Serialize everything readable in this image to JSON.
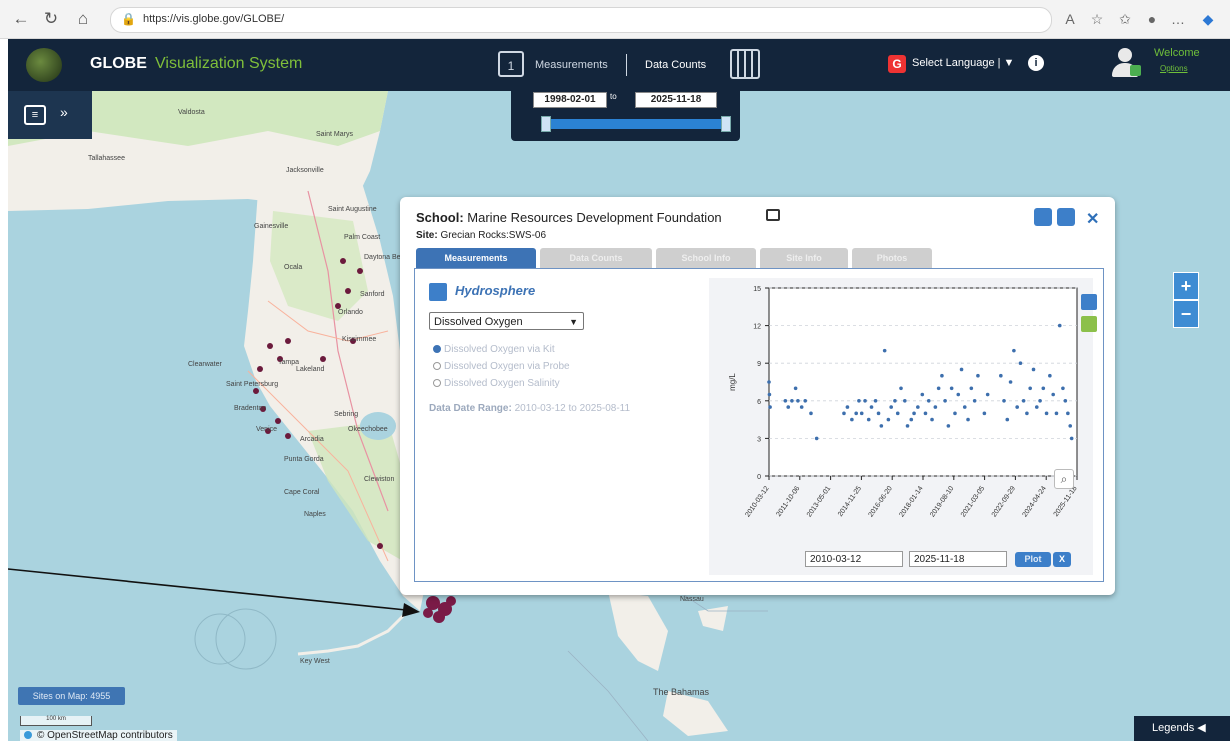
{
  "browser": {
    "url": "https://vis.globe.gov/GLOBE/"
  },
  "header": {
    "brand_main": "GLOBE",
    "brand_sub": "Visualization System",
    "measurements_label": "Measurements",
    "data_counts_label": "Data Counts",
    "language_label": "Select Language | ▼",
    "welcome_label": "Welcome",
    "options_label": "Options"
  },
  "date_range": {
    "start": "1998-02-01",
    "to_label": "to",
    "end": "2025-11-18",
    "slider_start_fraction": 0.0,
    "slider_end_fraction": 1.0
  },
  "map": {
    "sites_on_map": "Sites on Map: 4955",
    "scale_label": "100 km",
    "attribution": "© OpenStreetMap contributors",
    "legends_label": "Legends",
    "zoom_in": "+",
    "zoom_out": "−",
    "places": [
      "Valdosta",
      "Saint Marys",
      "Tallahassee",
      "Jacksonville",
      "Saint Augustine",
      "Gainesville",
      "Palm Coast",
      "Ocala",
      "Daytona Beach",
      "Sanford",
      "Orlando",
      "Kissimmee",
      "Clearwater",
      "Tampa",
      "Lakeland",
      "Saint Petersburg",
      "Bradenton",
      "Sebring",
      "Venice",
      "Arcadia",
      "Okeechobee",
      "Punta Gorda",
      "Cape Coral",
      "Clewiston",
      "Naples",
      "Key West",
      "Nassau",
      "The Bahamas"
    ]
  },
  "popup": {
    "school_label": "School:",
    "school_name": "Marine Resources Development Foundation",
    "site_label": "Site:",
    "site_name": "Grecian Rocks:SWS-06",
    "close": "✕",
    "tabs": [
      {
        "label": "Measurements",
        "active": true
      },
      {
        "label": "Data Counts",
        "active": false
      },
      {
        "label": "School Info",
        "active": false
      },
      {
        "label": "Site Info",
        "active": false
      },
      {
        "label": "Photos",
        "active": false
      }
    ],
    "sphere_title": "Hydrosphere",
    "selected_measure": "Dissolved Oxygen",
    "radios": [
      {
        "label": "Dissolved Oxygen via Kit",
        "checked": true
      },
      {
        "label": "Dissolved Oxygen via Probe",
        "checked": false
      },
      {
        "label": "Dissolved Oxygen Salinity",
        "checked": false
      }
    ],
    "data_range_label": "Data Date Range:",
    "data_range_value": "2010-03-12 to 2025-08-11",
    "plot_start": "2010-03-12",
    "plot_end": "2025-11-18",
    "plot_button": "Plot",
    "plot_clear": "X"
  },
  "chart_data": {
    "type": "scatter",
    "ylabel": "mg/L",
    "ylim": [
      0,
      15
    ],
    "yticks": [
      0,
      3,
      6,
      9,
      12,
      15
    ],
    "xlim": [
      "2010-03-12",
      "2025-11-18"
    ],
    "xticks": [
      "2010-03-12",
      "2011-10-06",
      "2013-05-01",
      "2014-11-25",
      "2016-06-20",
      "2018-01-14",
      "2019-08-10",
      "2021-03-05",
      "2022-09-29",
      "2024-04-24",
      "2025-11-18"
    ],
    "grid": true,
    "color": "#3d6fad",
    "points": [
      [
        "2010-03-12",
        7.5
      ],
      [
        "2010-03-20",
        6.5
      ],
      [
        "2010-04-01",
        5.5
      ],
      [
        "2011-01-10",
        6
      ],
      [
        "2011-03-05",
        5.5
      ],
      [
        "2011-05-12",
        6
      ],
      [
        "2011-07-20",
        7
      ],
      [
        "2011-09-01",
        6
      ],
      [
        "2011-11-10",
        5.5
      ],
      [
        "2012-01-15",
        6
      ],
      [
        "2012-05-01",
        5
      ],
      [
        "2012-08-15",
        3
      ],
      [
        "2014-01-05",
        5
      ],
      [
        "2014-03-10",
        5.5
      ],
      [
        "2014-06-01",
        4.5
      ],
      [
        "2014-08-20",
        5
      ],
      [
        "2014-10-10",
        6
      ],
      [
        "2014-12-01",
        5
      ],
      [
        "2015-02-01",
        6
      ],
      [
        "2015-04-10",
        4.5
      ],
      [
        "2015-06-01",
        5.5
      ],
      [
        "2015-08-15",
        6
      ],
      [
        "2015-10-10",
        5
      ],
      [
        "2015-12-01",
        4
      ],
      [
        "2016-02-01",
        10
      ],
      [
        "2016-04-10",
        4.5
      ],
      [
        "2016-06-01",
        5.5
      ],
      [
        "2016-08-10",
        6
      ],
      [
        "2016-10-01",
        5
      ],
      [
        "2016-12-01",
        7
      ],
      [
        "2017-02-10",
        6
      ],
      [
        "2017-04-01",
        4
      ],
      [
        "2017-06-10",
        4.5
      ],
      [
        "2017-08-01",
        5
      ],
      [
        "2017-10-10",
        5.5
      ],
      [
        "2018-01-01",
        6.5
      ],
      [
        "2018-03-01",
        5
      ],
      [
        "2018-05-01",
        6
      ],
      [
        "2018-07-01",
        4.5
      ],
      [
        "2018-09-01",
        5.5
      ],
      [
        "2018-11-01",
        7
      ],
      [
        "2019-01-01",
        8
      ],
      [
        "2019-03-01",
        6
      ],
      [
        "2019-05-01",
        4
      ],
      [
        "2019-07-01",
        7
      ],
      [
        "2019-09-01",
        5
      ],
      [
        "2019-11-01",
        6.5
      ],
      [
        "2020-01-01",
        8.5
      ],
      [
        "2020-03-01",
        5.5
      ],
      [
        "2020-05-01",
        4.5
      ],
      [
        "2020-07-01",
        7
      ],
      [
        "2020-09-01",
        6
      ],
      [
        "2020-11-01",
        8
      ],
      [
        "2021-03-01",
        5
      ],
      [
        "2021-05-01",
        6.5
      ],
      [
        "2022-01-01",
        8
      ],
      [
        "2022-03-01",
        6
      ],
      [
        "2022-05-01",
        4.5
      ],
      [
        "2022-07-01",
        7.5
      ],
      [
        "2022-09-01",
        10
      ],
      [
        "2022-11-01",
        5.5
      ],
      [
        "2023-01-01",
        9
      ],
      [
        "2023-03-01",
        6
      ],
      [
        "2023-05-01",
        5
      ],
      [
        "2023-07-01",
        7
      ],
      [
        "2023-09-01",
        8.5
      ],
      [
        "2023-11-01",
        5.5
      ],
      [
        "2024-01-01",
        6
      ],
      [
        "2024-03-01",
        7
      ],
      [
        "2024-05-01",
        5
      ],
      [
        "2024-07-01",
        8
      ],
      [
        "2024-09-01",
        6.5
      ],
      [
        "2024-11-01",
        5
      ],
      [
        "2025-01-01",
        12
      ],
      [
        "2025-03-01",
        7
      ],
      [
        "2025-04-15",
        6
      ],
      [
        "2025-06-01",
        5
      ],
      [
        "2025-07-15",
        4
      ],
      [
        "2025-08-11",
        3
      ]
    ]
  },
  "colors": {
    "header_bg": "#13253b",
    "accent_green": "#7fbf3a",
    "accent_blue": "#3d73b5",
    "map_water": "#aad3df",
    "map_land": "#f2efe9"
  }
}
